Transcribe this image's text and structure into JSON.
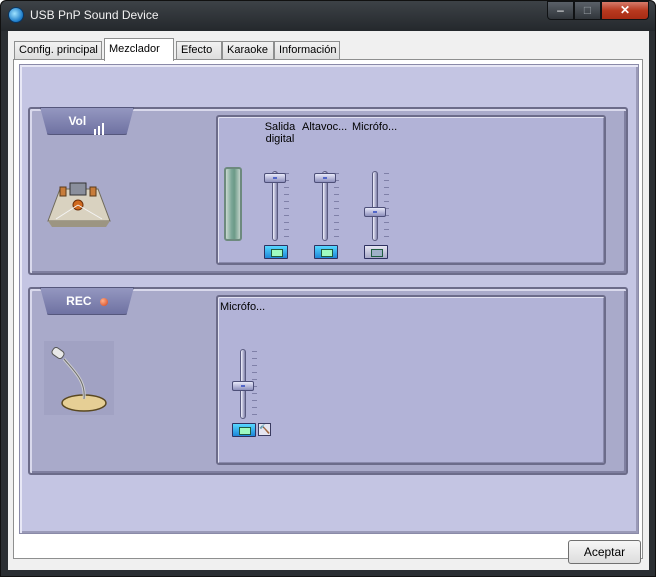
{
  "window": {
    "title": "USB PnP Sound Device",
    "controls": {
      "minimize": "–",
      "maximize": "□",
      "close": "✕"
    }
  },
  "tabs": [
    {
      "label": "Config. principal"
    },
    {
      "label": "Mezclador",
      "active": true
    },
    {
      "label": "Efecto"
    },
    {
      "label": "Karaoke"
    },
    {
      "label": "Información"
    }
  ],
  "playback": {
    "label": "Vol",
    "icon": "speaker-room-icon",
    "channels": [
      {
        "label": "Salida digital",
        "level": 0.95,
        "muted": false
      },
      {
        "label": "Altavoc...",
        "level": 0.95,
        "muted": false
      },
      {
        "label": "Micrófo...",
        "level": 0.4,
        "muted": true
      }
    ]
  },
  "recording": {
    "label": "REC",
    "icon": "microphone-icon",
    "channels": [
      {
        "label": "Micrófo...",
        "level": 0.45,
        "muted": false,
        "advanced_button": "🔨"
      }
    ]
  },
  "footer": {
    "accept_label": "Aceptar"
  },
  "colors": {
    "panel_background": "#a9aaca",
    "area_background": "#c4c5e3",
    "mute_active": "#1e86d8"
  }
}
